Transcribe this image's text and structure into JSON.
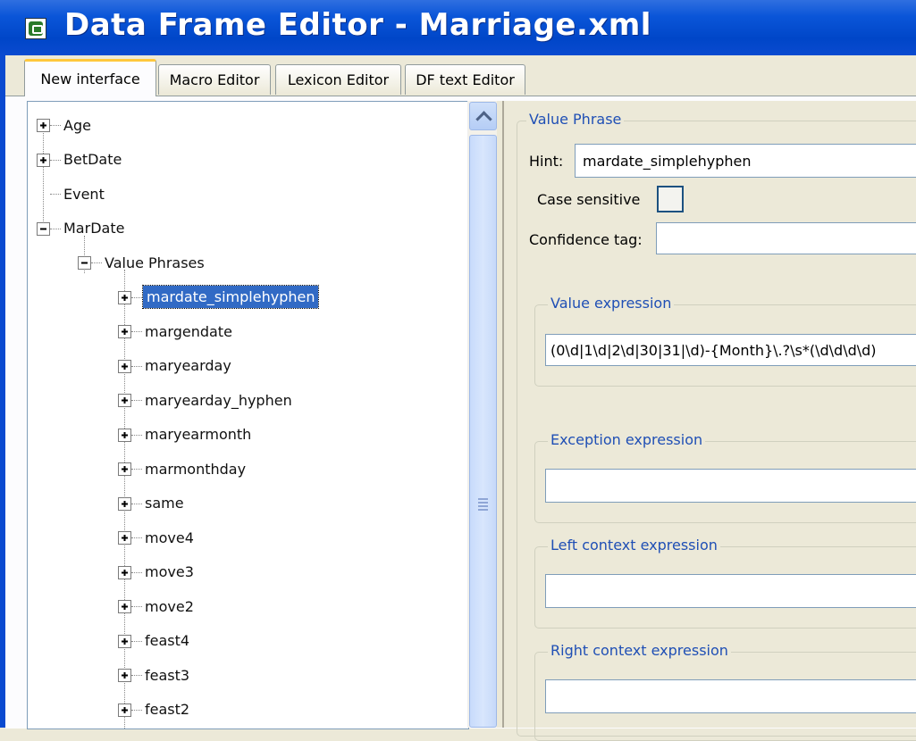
{
  "window": {
    "title": "Data Frame Editor - Marriage.xml",
    "app_icon": "java-app-icon"
  },
  "tabs": [
    {
      "label": "New interface",
      "active": true
    },
    {
      "label": "Macro Editor",
      "active": false
    },
    {
      "label": "Lexicon Editor",
      "active": false
    },
    {
      "label": "DF text Editor",
      "active": false
    }
  ],
  "tree": {
    "nodes": [
      {
        "label": "Age",
        "expander": "plus"
      },
      {
        "label": "BetDate",
        "expander": "plus"
      },
      {
        "label": "Event",
        "expander": "none"
      },
      {
        "label": "MarDate",
        "expander": "minus"
      },
      {
        "label": "Value Phrases",
        "expander": "minus"
      },
      {
        "label": "mardate_simplehyphen",
        "expander": "plus",
        "selected": true
      },
      {
        "label": "margendate",
        "expander": "plus"
      },
      {
        "label": "maryearday",
        "expander": "plus"
      },
      {
        "label": "maryearday_hyphen",
        "expander": "plus"
      },
      {
        "label": "maryearmonth",
        "expander": "plus"
      },
      {
        "label": "marmonthday",
        "expander": "plus"
      },
      {
        "label": "same",
        "expander": "plus"
      },
      {
        "label": "move4",
        "expander": "plus"
      },
      {
        "label": "move3",
        "expander": "plus"
      },
      {
        "label": "move2",
        "expander": "plus"
      },
      {
        "label": "feast4",
        "expander": "plus"
      },
      {
        "label": "feast3",
        "expander": "plus"
      },
      {
        "label": "feast2",
        "expander": "plus"
      }
    ]
  },
  "value_phrase": {
    "group_title": "Value Phrase",
    "hint_label": "Hint:",
    "hint_value": "mardate_simplehyphen",
    "case_sensitive_label": "Case sensitive",
    "case_sensitive_checked": false,
    "confidence_label": "Confidence tag:",
    "confidence_value": "",
    "value_expression_title": "Value expression",
    "value_expression": "(0\\d|1\\d|2\\d|30|31|\\d)-{Month}\\.?\\s*(\\d\\d\\d\\d)",
    "exception_title": "Exception expression",
    "exception_value": "",
    "left_context_title": "Left context expression",
    "left_context_value": "",
    "right_context_title": "Right context expression",
    "right_context_value": ""
  }
}
